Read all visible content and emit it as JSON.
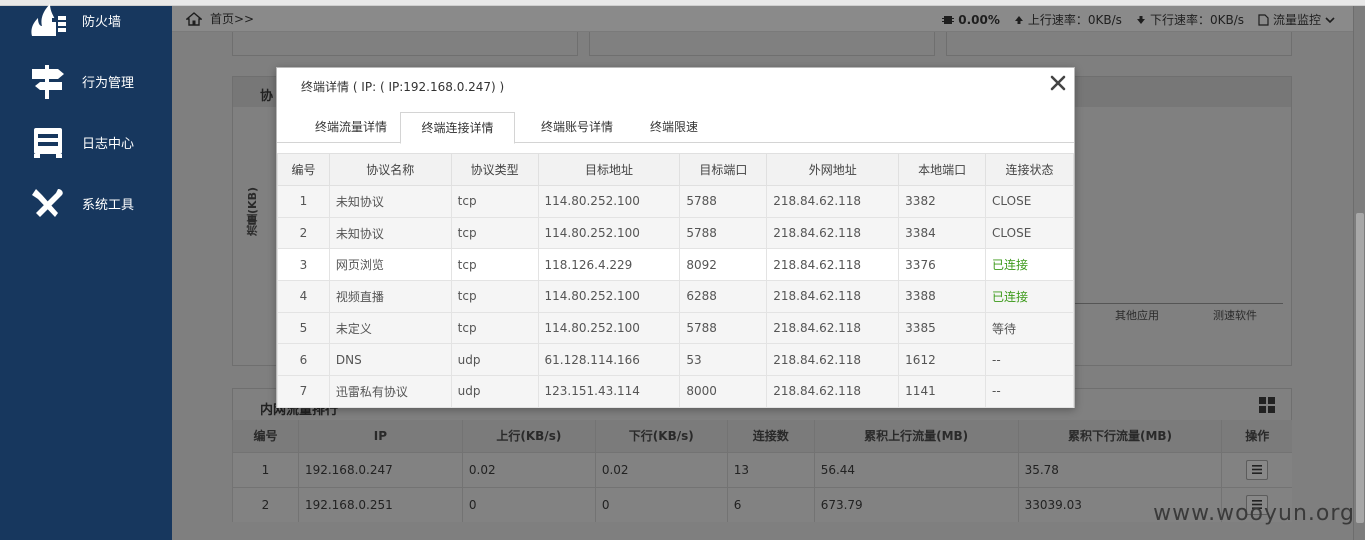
{
  "sidebar": {
    "items": [
      {
        "label": "防火墙",
        "icon": "firewall-icon"
      },
      {
        "label": "行为管理",
        "icon": "signpost-icon"
      },
      {
        "label": "日志中心",
        "icon": "log-icon"
      },
      {
        "label": "系统工具",
        "icon": "tools-icon"
      }
    ]
  },
  "header": {
    "breadcrumb": "首页>>",
    "cpu_value": "0.00%",
    "upload_label": "上行速率：",
    "upload_value": "0KB/s",
    "download_label": "下行速率：",
    "download_value": "0KB/s",
    "monitor_label": "流量监控"
  },
  "background": {
    "protocol_panel_title": "协",
    "y_axis_label": "流量(KB)",
    "axis_labels": [
      "其他应用",
      "测速软件"
    ],
    "lan_panel_title": "内网流量排行"
  },
  "lan_table": {
    "columns": [
      "编号",
      "IP",
      "上行(KB/s)",
      "下行(KB/s)",
      "连接数",
      "累积上行流量(MB)",
      "累积下行流量(MB)",
      "操作"
    ],
    "rows": [
      [
        "1",
        "192.168.0.247",
        "0.02",
        "0.02",
        "13",
        "56.44",
        "35.78"
      ],
      [
        "2",
        "192.168.0.251",
        "0",
        "0",
        "6",
        "673.79",
        "33039.03"
      ]
    ]
  },
  "modal": {
    "title": "终端详情 ( IP: ( IP:192.168.0.247) )",
    "tabs": [
      "终端流量详情",
      "终端连接详情",
      "终端账号详情",
      "终端限速"
    ],
    "active_tab": "终端连接详情",
    "columns": [
      "编号",
      "协议名称",
      "协议类型",
      "目标地址",
      "目标端口",
      "外网地址",
      "本地端口",
      "连接状态"
    ],
    "rows": [
      [
        "1",
        "未知协议",
        "tcp",
        "114.80.252.100",
        "5788",
        "218.84.62.118",
        "3382",
        "CLOSE"
      ],
      [
        "2",
        "未知协议",
        "tcp",
        "114.80.252.100",
        "5788",
        "218.84.62.118",
        "3384",
        "CLOSE"
      ],
      [
        "3",
        "网页浏览",
        "tcp",
        "118.126.4.229",
        "8092",
        "218.84.62.118",
        "3376",
        "已连接"
      ],
      [
        "4",
        "视频直播",
        "tcp",
        "114.80.252.100",
        "6288",
        "218.84.62.118",
        "3388",
        "已连接"
      ],
      [
        "5",
        "未定义",
        "tcp",
        "114.80.252.100",
        "5788",
        "218.84.62.118",
        "3385",
        "等待"
      ],
      [
        "6",
        "DNS",
        "udp",
        "61.128.114.166",
        "53",
        "218.84.62.118",
        "1612",
        "--"
      ],
      [
        "7",
        "迅雷私有协议",
        "udp",
        "123.151.43.114",
        "8000",
        "218.84.62.118",
        "1141",
        "--"
      ]
    ],
    "status_connected_color": "#3c9a1a"
  },
  "watermark": "www.wooyun.org",
  "colors": {
    "sidebar": "#17375e",
    "overlay": "#7f7f7f"
  }
}
